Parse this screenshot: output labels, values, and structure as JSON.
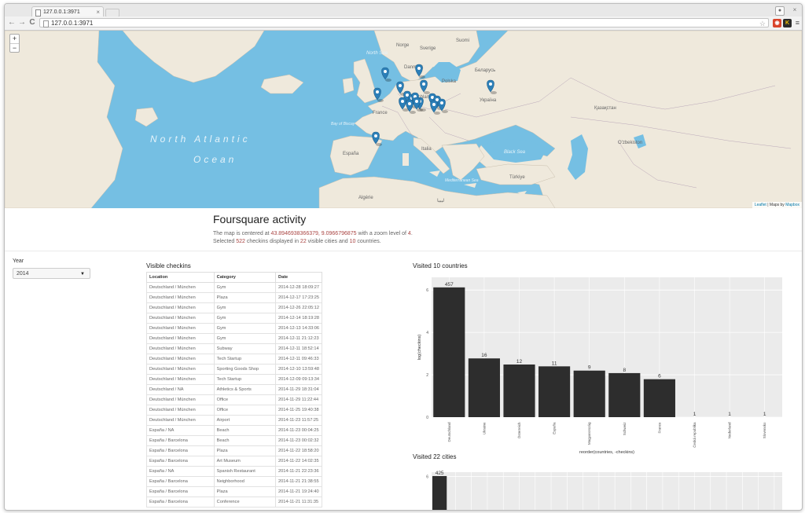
{
  "browser": {
    "tab_title": "127.0.0.1:3971",
    "tab_close": "×",
    "url": "127.0.0.1:3971",
    "back": "←",
    "forward": "→",
    "reload": "C",
    "star": "☆",
    "menu": "≡"
  },
  "map": {
    "zoom_in": "+",
    "zoom_out": "−",
    "attribution_prefix": "Leaflet",
    "attribution_sep": " | Maps by ",
    "attribution_link": "Mapbox",
    "labels": {
      "ocean1": "North Atlantic",
      "ocean2": "Ocean",
      "north_sea": "North Sea",
      "black_sea": "Black Sea",
      "med_sea": "Mediterranean Sea",
      "biscay": "Bay of Biscay",
      "france": "France",
      "espana": "España",
      "italia": "Italia",
      "deutschland": "Deutschland",
      "polska": "Polska",
      "ukraina": "Україна",
      "belarus": "Беларусь",
      "turkiye": "Türkiye",
      "kazakhstan": "Қазақстан",
      "ozbekiston": "O'zbekiston",
      "algerie": "Algérie",
      "libya": "ليبيا",
      "sverige": "Sverige",
      "norge": "Norge",
      "danmark": "Danmark",
      "suomi": "Suomi"
    },
    "marker_count": 18
  },
  "page": {
    "title": "Foursquare activity",
    "line1_a": "The map is centered at ",
    "center": "43.8946938366379, 9.0966796875",
    "line1_b": " with a zoom level of ",
    "zoom": "4",
    "line1_c": ".",
    "line2_a": "Selected ",
    "checkins": "522",
    "line2_b": " checkins displayed in ",
    "cities": "22",
    "line2_c": " visible cities and ",
    "countries": "10",
    "line2_d": " countries."
  },
  "sidebar": {
    "year_label": "Year",
    "year_value": "2014"
  },
  "checkins": {
    "heading": "Visible checkins",
    "columns": [
      "Location",
      "Category",
      "Date"
    ],
    "rows": [
      [
        "Deutschland / München",
        "Gym",
        "2014-12-28 18:09:27"
      ],
      [
        "Deutschland / München",
        "Plaza",
        "2014-12-17 17:23:25"
      ],
      [
        "Deutschland / München",
        "Gym",
        "2014-12-26 22:05:12"
      ],
      [
        "Deutschland / München",
        "Gym",
        "2014-12-14 18:19:28"
      ],
      [
        "Deutschland / München",
        "Gym",
        "2014-12-13 14:33:06"
      ],
      [
        "Deutschland / München",
        "Gym",
        "2014-12-11 21:12:23"
      ],
      [
        "Deutschland / München",
        "Subway",
        "2014-12-11 18:52:14"
      ],
      [
        "Deutschland / München",
        "Tech Startup",
        "2014-12-11 09:46:33"
      ],
      [
        "Deutschland / München",
        "Sporting Goods Shop",
        "2014-12-10 13:59:48"
      ],
      [
        "Deutschland / München",
        "Tech Startup",
        "2014-12-09 09:13:34"
      ],
      [
        "Deutschland / NA",
        "Athletics & Sports",
        "2014-11-29 18:31:04"
      ],
      [
        "Deutschland / München",
        "Office",
        "2014-11-29 11:22:44"
      ],
      [
        "Deutschland / München",
        "Office",
        "2014-11-25 19:40:38"
      ],
      [
        "Deutschland / München",
        "Airport",
        "2014-11-23 11:57:25"
      ],
      [
        "España / NA",
        "Beach",
        "2014-11-23 00:04:25"
      ],
      [
        "España / Barcelona",
        "Beach",
        "2014-11-23 00:02:32"
      ],
      [
        "España / Barcelona",
        "Plaza",
        "2014-11-22 18:58:20"
      ],
      [
        "España / Barcelona",
        "Art Museum",
        "2014-11-22 14:02:35"
      ],
      [
        "España / NA",
        "Spanish Restaurant",
        "2014-11-21 22:23:36"
      ],
      [
        "España / Barcelona",
        "Neighborhood",
        "2014-11-21 21:38:55"
      ],
      [
        "España / Barcelona",
        "Plaza",
        "2014-11-21 19:24:40"
      ],
      [
        "España / Barcelona",
        "Conference",
        "2014-11-21 11:31:35"
      ]
    ]
  },
  "countries_heading": "Visited 10 countries",
  "cities_heading": "Visited 22 cities",
  "chart_data": [
    {
      "type": "bar",
      "title": "Visited 10 countries",
      "xlabel": "reorder(countries, -checkins)",
      "ylabel": "log(checkins)",
      "categories": [
        "Deutschland",
        "Ukraine",
        "Österreich",
        "España",
        "Magyarország",
        "Schweiz",
        "France",
        "Česká republika",
        "Nederland",
        "Slovensko"
      ],
      "values": [
        457,
        16,
        12,
        11,
        9,
        8,
        6,
        1,
        1,
        1
      ],
      "y_ticks": [
        0,
        2,
        4,
        6
      ],
      "ylim": [
        0,
        6.6
      ],
      "log_scale": true,
      "grid": true,
      "bar_color": "#2d2d2d",
      "panel_color": "#ebebeb"
    },
    {
      "type": "bar",
      "title": "Visited 22 cities",
      "categories": [
        ""
      ],
      "values": [
        425
      ],
      "y_ticks": [
        6
      ],
      "ylim": [
        0,
        6.6
      ],
      "log_scale": true,
      "grid": true,
      "bar_color": "#2d2d2d",
      "panel_color": "#ebebeb"
    }
  ]
}
